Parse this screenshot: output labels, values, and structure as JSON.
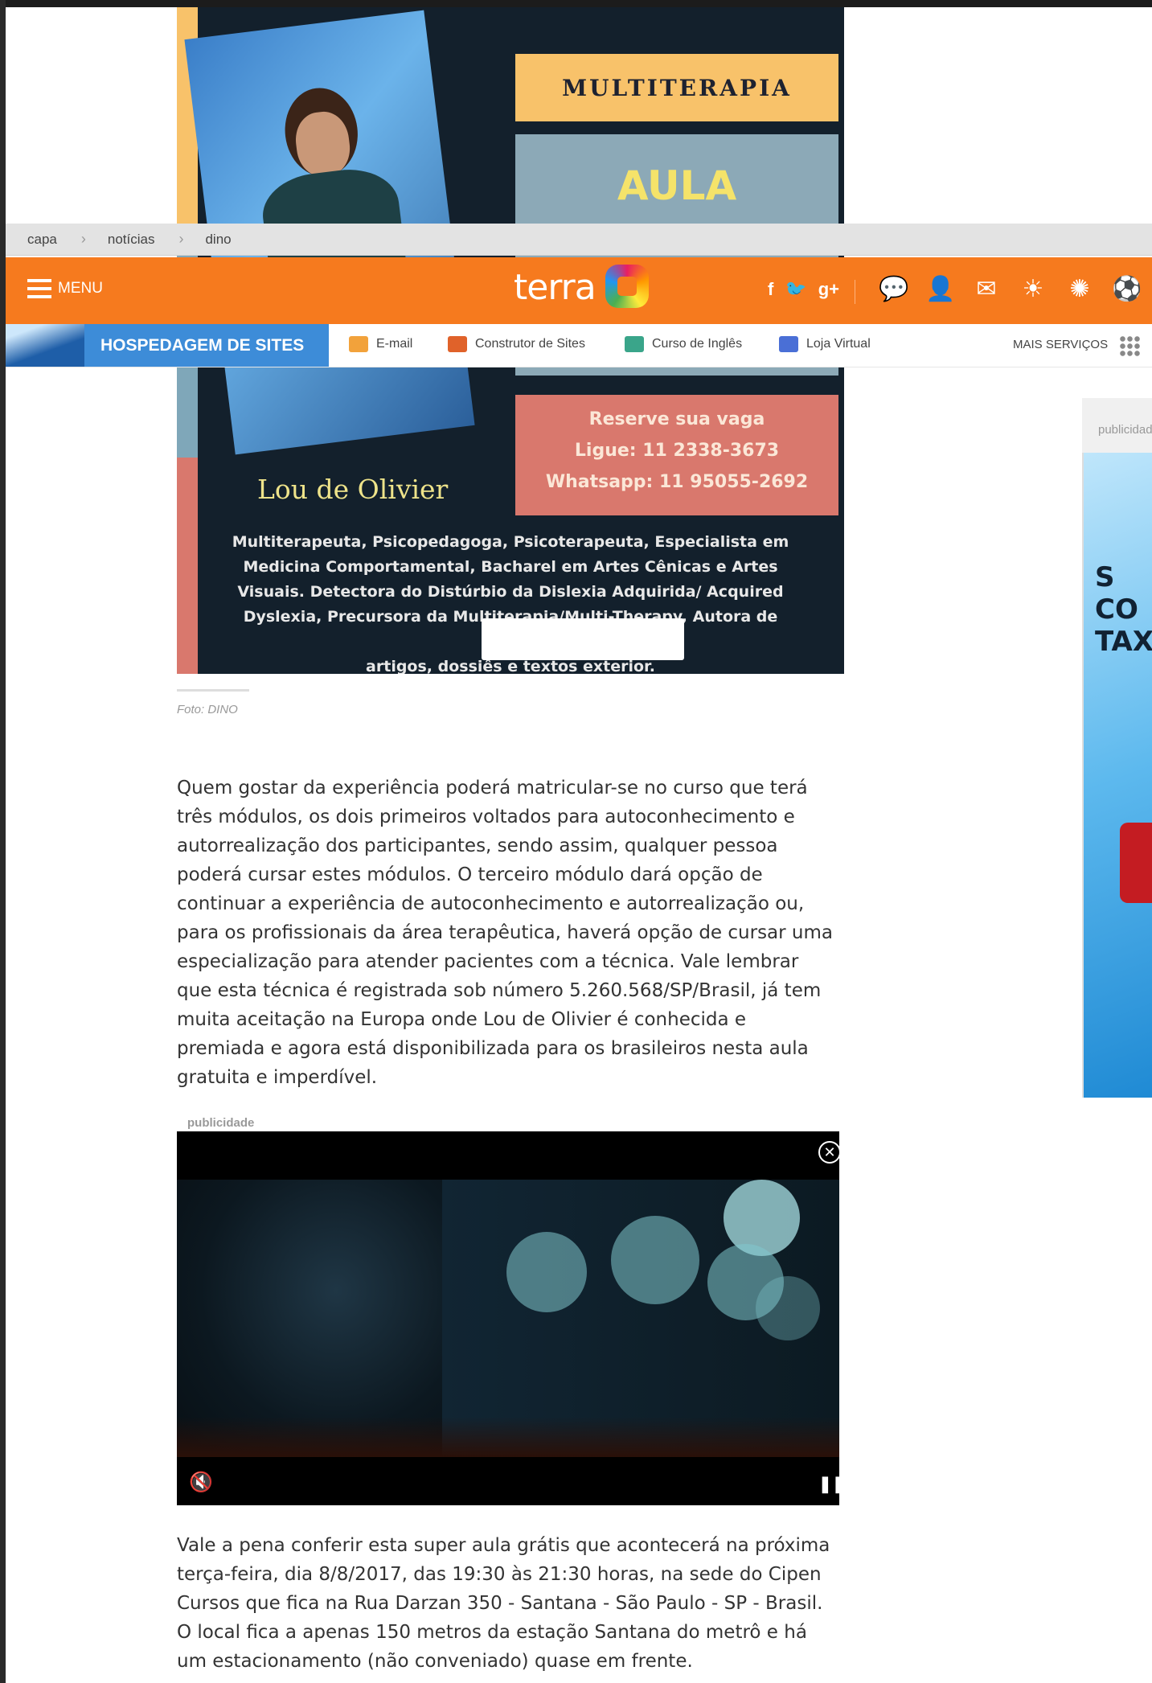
{
  "promo": {
    "title": "MULTITERAPIA",
    "subtitle": "AULA",
    "reserve": "Reserve sua vaga",
    "phone": "Ligue:  11 2338-3673",
    "whatsapp": "Whatsapp:  11 95055-2692",
    "name": "Lou de Olivier",
    "bio_lines": [
      "Multiterapeuta, Psicopedagoga, Psicoterapeuta, Especialista em",
      "Medicina Comportamental, Bacharel em Artes Cênicas e Artes",
      "Visuais. Detectora do Distúrbio da Dislexia Adquirida/ Acquired",
      "Dyslexia, Precursora da Multiterapia/Multi-Therapy, Autora de muitos",
      "artigos, dossiês e textos                                  exterior."
    ]
  },
  "breadcrumb": [
    "capa",
    "notícias",
    "dino"
  ],
  "header": {
    "menu_label": "MENU",
    "logo_text": "terra",
    "social": [
      "f",
      "🐦",
      "g+"
    ],
    "icons": [
      "chat-icon",
      "user-icon",
      "mail-icon",
      "weather-icon",
      "horoscope-icon",
      "soccer-icon"
    ]
  },
  "services": {
    "hosting": "HOSPEDAGEM DE SITES",
    "items": [
      "E-mail",
      "Construtor de Sites",
      "Curso de Inglês",
      "Loja Virtual"
    ],
    "more": "MAIS SERVIÇOS"
  },
  "caption": "Foto: DINO",
  "article": {
    "p1": "Quem gostar da experiência poderá matricular-se no curso que terá três módulos, os dois primeiros voltados para autoconhecimento e autorrealização dos participantes, sendo assim, qualquer pessoa poderá cursar estes módulos. O terceiro módulo dará opção de continuar a experiência de autoconhecimento e autorrealização ou, para os profissionais da área terapêutica, haverá opção de cursar uma especialização para atender pacientes com a técnica. Vale lembrar que esta técnica é registrada sob número 5.260.568/SP/Brasil, já tem muita aceitação na Europa onde Lou de Olivier é conhecida e premiada e agora está disponibilizada para os brasileiros nesta aula gratuita e imperdível.",
    "p2": "Vale a pena conferir esta super aula grátis que acontecerá na próxima terça-feira, dia 8/8/2017, das 19:30 às 21:30 horas, na sede do Cipen Cursos que fica na Rua Darzan 350 - Santana - São Paulo - SP - Brasil. O local fica a apenas 150 metros da estação Santana do metrô e há um estacionamento (não conveniado) quase em frente."
  },
  "ads": {
    "side_label": "publicidade",
    "side_text": [
      "S",
      "CO",
      "TAX"
    ],
    "video_label": "publicidade"
  }
}
